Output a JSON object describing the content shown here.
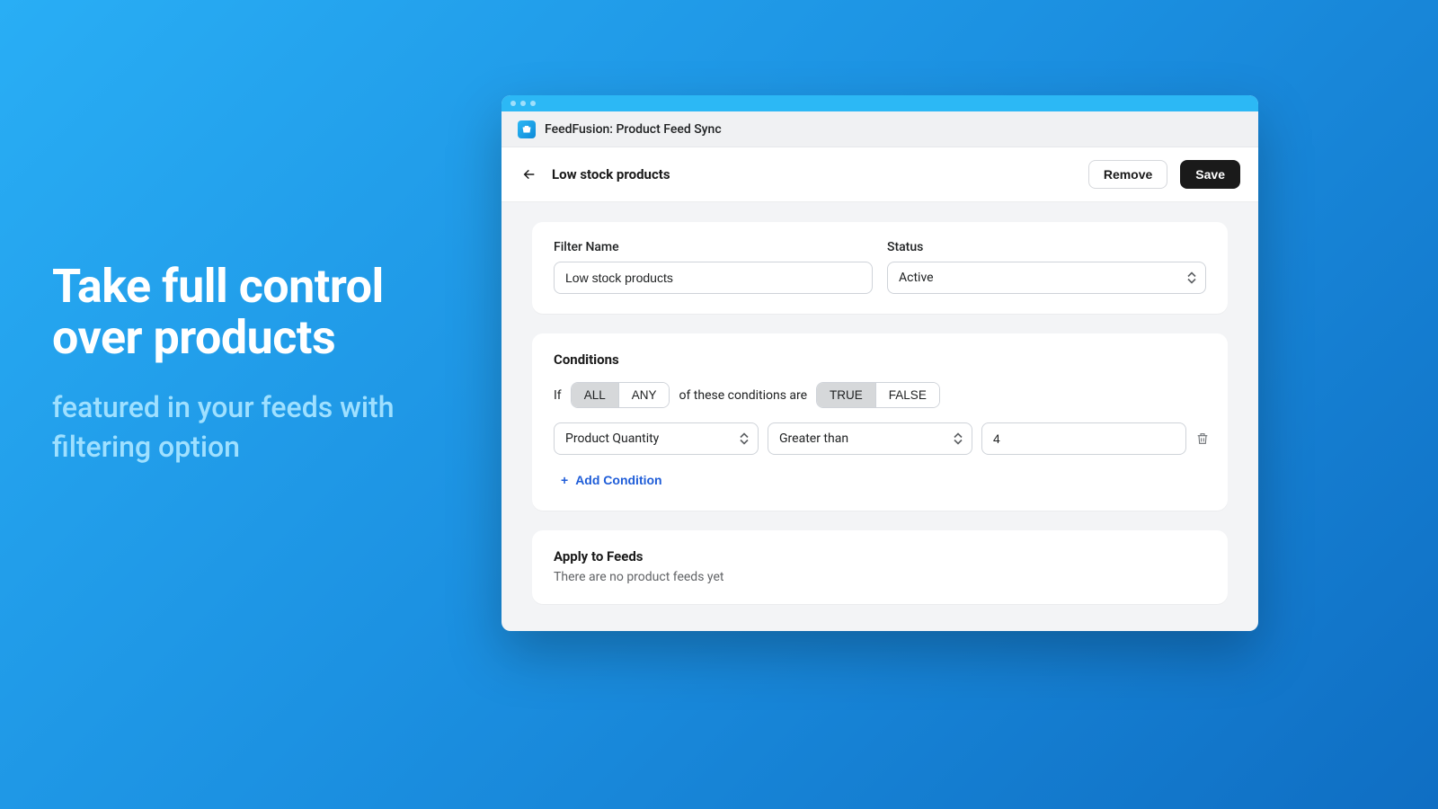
{
  "marketing": {
    "headline": "Take full control over products",
    "subline": "featured in your feeds with filtering option"
  },
  "app": {
    "title": "FeedFusion: Product Feed Sync"
  },
  "header": {
    "page_title": "Low stock products",
    "remove": "Remove",
    "save": "Save"
  },
  "filter_card": {
    "name_label": "Filter Name",
    "name_value": "Low stock products",
    "status_label": "Status",
    "status_value": "Active"
  },
  "conditions": {
    "title": "Conditions",
    "if_text": "If",
    "all": "ALL",
    "any": "ANY",
    "mid_text": "of these conditions are",
    "true": "TRUE",
    "false": "FALSE",
    "row": {
      "field": "Product Quantity",
      "op": "Greater than",
      "value": "4"
    },
    "add": "Add Condition"
  },
  "apply": {
    "title": "Apply to Feeds",
    "empty": "There are no product feeds yet"
  }
}
